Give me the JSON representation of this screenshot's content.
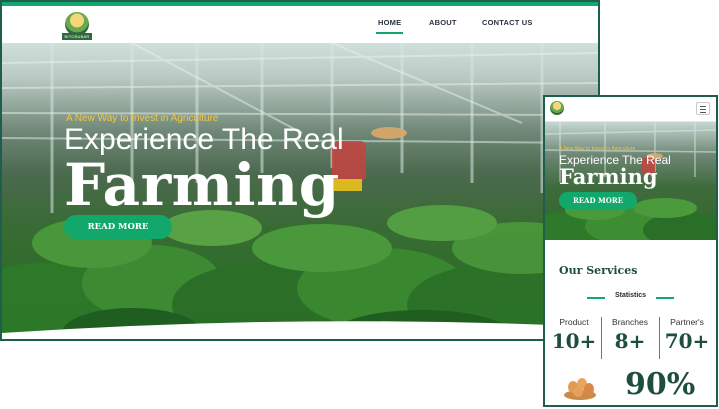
{
  "desktop": {
    "logo_text": "BITCRUBAR",
    "nav": [
      {
        "label": "HOME",
        "active": true
      },
      {
        "label": "ABOUT",
        "active": false
      },
      {
        "label": "CONTACT US",
        "active": false
      }
    ],
    "hero": {
      "tagline": "A New Way to Invest in Agriculture",
      "heading_line1": "Experience The Real",
      "heading_line2": "Farming",
      "button_label": "READ MORE"
    }
  },
  "mobile": {
    "menu_icon": "hamburger-icon",
    "hero": {
      "tagline": "A New Way to Invest in Agriculture",
      "heading_line1": "Experience The Real",
      "heading_line2": "Farming",
      "button_label": "READ MORE"
    },
    "services_title": "Our Services",
    "statistics_label": "Statistics",
    "stats": [
      {
        "label": "Product",
        "value": "10+"
      },
      {
        "label": "Branches",
        "value": "8+"
      },
      {
        "label": "Partner's",
        "value": "70+"
      }
    ],
    "percentage": "90%"
  },
  "colors": {
    "accent": "#13a86b",
    "frame": "#1f5e4e",
    "heading": "#1f4e3d",
    "tagline": "#f1c644"
  }
}
